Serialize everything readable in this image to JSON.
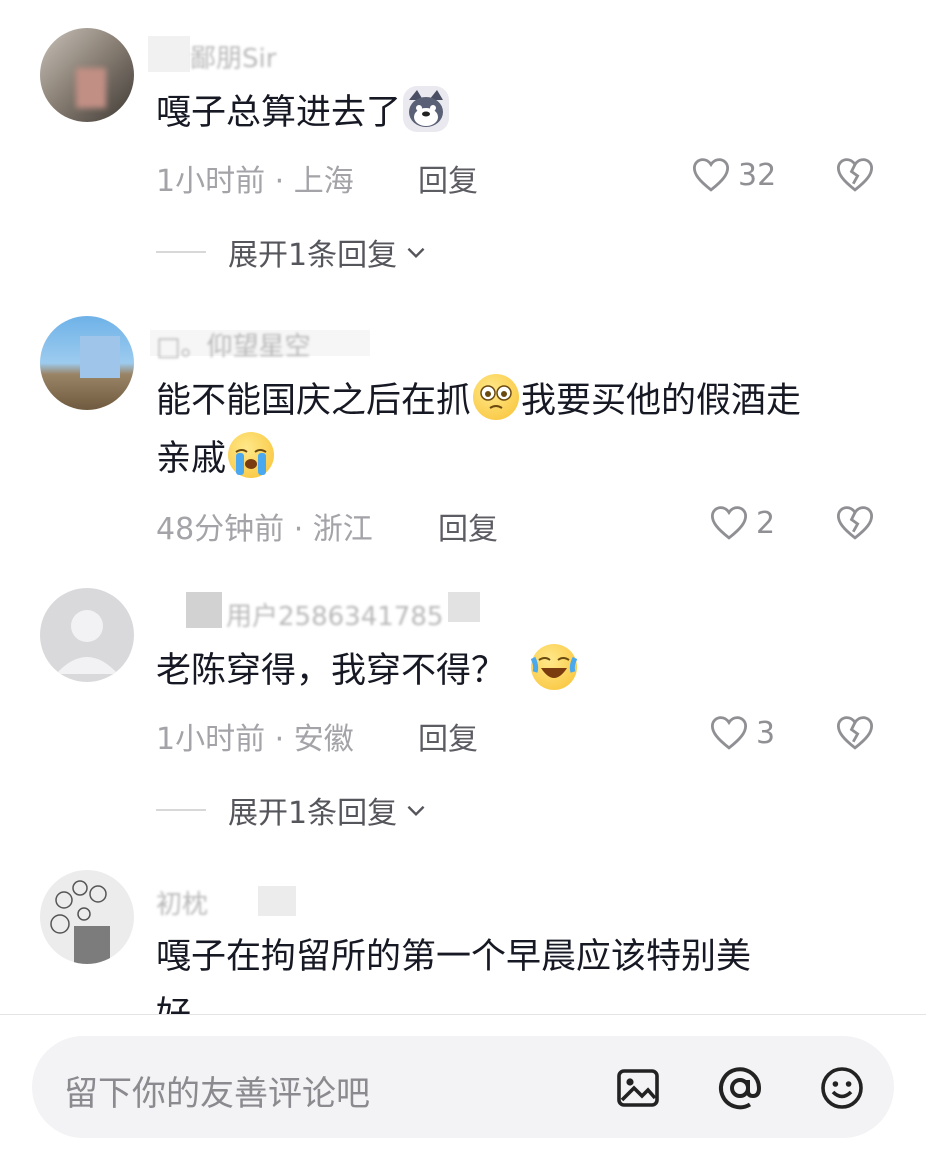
{
  "comments": [
    {
      "username": "鄙朋Sir",
      "text": "嘎子总算进去了",
      "meta": "1小时前 · 上海",
      "reply_label": "回复",
      "likes": "32",
      "expand_label": "展开1条回复"
    },
    {
      "username": "□。仰望星空",
      "text_line1": "能不能国庆之后在抓",
      "text_line1b": "我要买他的假酒走",
      "text_line2": "亲戚",
      "meta": "48分钟前 · 浙江",
      "reply_label": "回复",
      "likes": "2"
    },
    {
      "username": "用户2586341785",
      "text": "老陈穿得，我穿不得？",
      "meta": "1小时前 · 安徽",
      "reply_label": "回复",
      "likes": "3",
      "expand_label": "展开1条回复"
    },
    {
      "username": "初枕",
      "text_line1": "嘎子在拘留所的第一个早晨应该特别美",
      "text_line2": "好"
    }
  ],
  "input": {
    "placeholder": "留下你的友善评论吧"
  },
  "icons": [
    "heart-icon",
    "broken-heart-icon",
    "chevron-down-icon",
    "image-icon",
    "at-icon",
    "smiley-icon"
  ],
  "colors": {
    "text": "#161823",
    "meta": "#a3a3a8",
    "input_bg": "#f3f3f5"
  }
}
